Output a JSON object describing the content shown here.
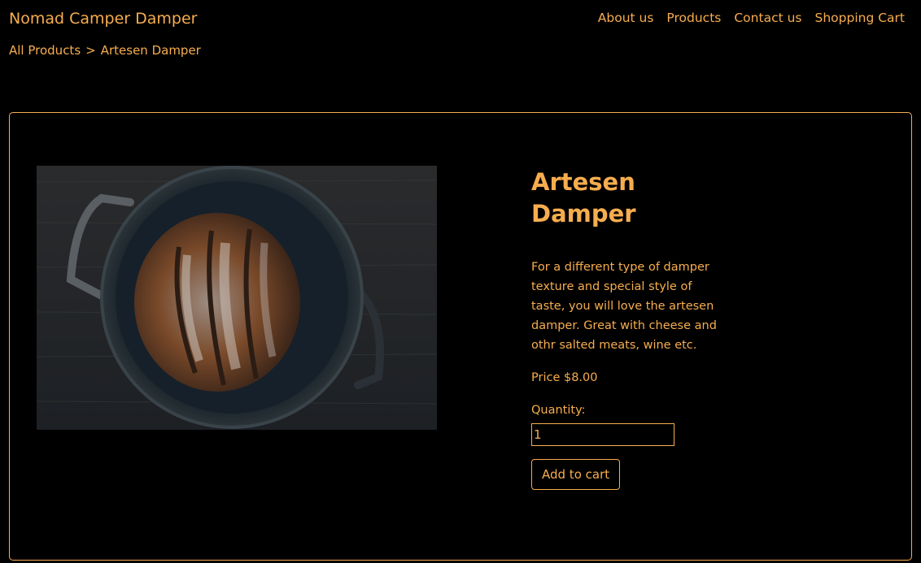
{
  "header": {
    "brand": "Nomad Camper Damper",
    "nav": [
      {
        "label": "About us"
      },
      {
        "label": "Products"
      },
      {
        "label": "Contact us"
      },
      {
        "label": "Shopping Cart"
      }
    ]
  },
  "breadcrumb": {
    "root": "All Products",
    "separator": ">",
    "current": "Artesen Damper"
  },
  "product": {
    "title": "Artesen Damper",
    "description": "For a different type of damper texture and special style of taste, you will love the artesen damper. Great with cheese and othr salted meats, wine etc.",
    "price": "Price $8.00",
    "quantity_label": "Quantity:",
    "quantity_value": "1",
    "add_button_label": "Add to cart",
    "image_icon": "damper-bread-in-cast-iron-pot-photo"
  },
  "colors": {
    "background": "#000000",
    "accent": "#f7ad4e"
  }
}
